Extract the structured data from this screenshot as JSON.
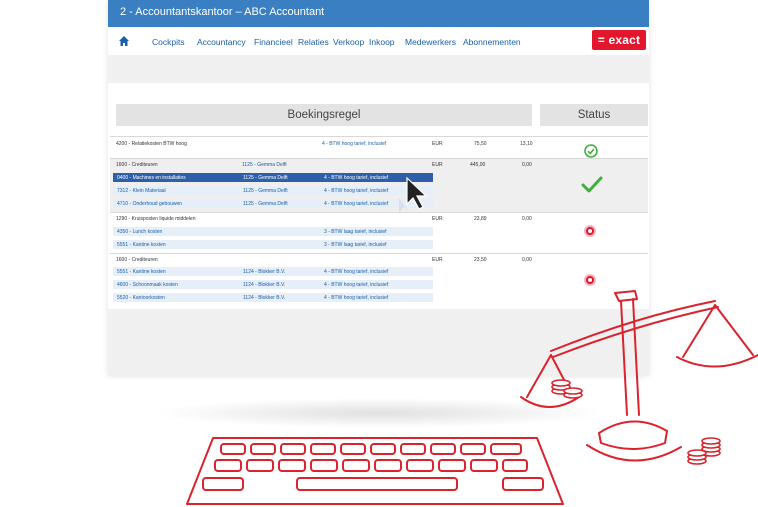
{
  "window": {
    "title": "2 - Accountantskantoor – ABC Accountant"
  },
  "nav": {
    "home_icon": "home-icon",
    "items": [
      "Cockpits",
      "Accountancy",
      "Financieel",
      "Relaties",
      "Verkoop",
      "Inkoop",
      "Medewerkers",
      "Abonnementen"
    ]
  },
  "brand": {
    "logo": "= exact",
    "color": "#e2162c"
  },
  "columns": {
    "booking": "Boekingsregel",
    "status": "Status"
  },
  "groups": [
    {
      "account": "4200 - Relatiekosten BTW hoog",
      "vat": "4 - BTW hoog tarief, inclusief",
      "currency": "EUR",
      "amount": "75,50",
      "vat_amount": "13,10",
      "status": "ok",
      "lines": []
    },
    {
      "account": "1600 - Crediteuren",
      "relation": "1125 - Gemma Delft",
      "currency": "EUR",
      "amount": "445,00",
      "vat_amount": "0,00",
      "status": "ok",
      "lines": [
        {
          "account": "0400 - Machines en installaties",
          "relation": "1125 - Gemma Delft",
          "vat": "4 - BTW hoog tarief, inclusief",
          "selected": true
        },
        {
          "account": "7312 - Klein Materiaal",
          "relation": "1125 - Gemma Delft",
          "vat": "4 - BTW hoog tarief, inclusief"
        },
        {
          "account": "4710 - Onderhoud gebouwen",
          "relation": "1125 - Gemma Delft",
          "vat": "4 - BTW hoog tarief, inclusief"
        }
      ]
    },
    {
      "account": "1290 - Kruisposten liquide middelen",
      "currency": "EUR",
      "amount": "23,89",
      "vat_amount": "0,00",
      "status": "error",
      "lines": [
        {
          "account": "4350 - Lunch kosten",
          "vat": "3 - BTW laag tarief, inclusief"
        },
        {
          "account": "5551 - Kantine kosten",
          "vat": "3 - BTW laag tarief, inclusief"
        }
      ]
    },
    {
      "account": "1600 - Crediteuren",
      "currency": "EUR",
      "amount": "23,50",
      "vat_amount": "0,00",
      "status": "error",
      "lines": [
        {
          "account": "5551 - Kantine kosten",
          "relation": "1124 - Blokker B.V.",
          "vat": "4 - BTW hoog tarief, inclusief"
        },
        {
          "account": "4600 - Schoonmaak kosten",
          "relation": "1124 - Blokker B.V.",
          "vat": "4 - BTW hoog tarief, inclusief"
        },
        {
          "account": "5520 - Kantoorkosten",
          "relation": "1124 - Blokker B.V.",
          "vat": "4 - BTW hoog tarief, inclusief"
        }
      ]
    }
  ],
  "illustration": {
    "scale": "balance-scale-illustration",
    "keyboard": "keyboard-illustration",
    "coins": "coins-illustration",
    "cursor": "cursor-icon"
  }
}
